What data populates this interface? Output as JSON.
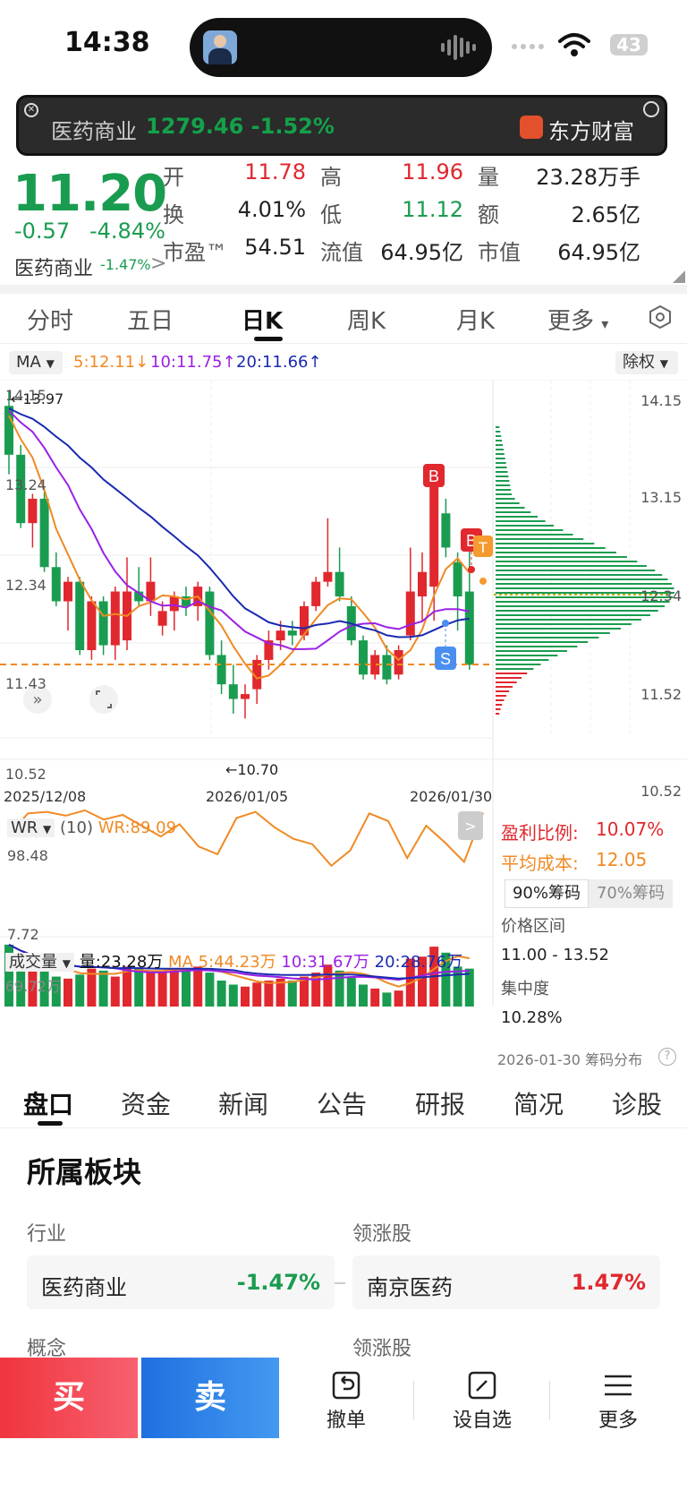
{
  "status_bar": {
    "time": "14:38",
    "battery": "43"
  },
  "banner": {
    "index_name": "医药商业",
    "index_value": "1279.46",
    "index_change": "-1.52%",
    "app_name": "东方财富"
  },
  "quote": {
    "price": "11.20",
    "change": "-0.57",
    "change_pct": "-4.84%",
    "industry": "医药商业",
    "industry_pct": "-1.47%",
    "industry_arrow": ">",
    "labels": {
      "open": "开",
      "high": "高",
      "volume": "量",
      "turnover": "换",
      "low": "低",
      "amount": "额",
      "pe": "市盈™",
      "float_cap": "流值",
      "market_cap": "市值"
    },
    "open": "11.78",
    "high": "11.96",
    "volume": "23.28万手",
    "turnover": "4.01%",
    "low": "11.12",
    "amount": "2.65亿",
    "pe": "54.51",
    "float_cap": "64.95亿",
    "market_cap": "64.95亿"
  },
  "tabs": [
    "分时",
    "五日",
    "日K",
    "周K",
    "月K",
    "更多"
  ],
  "tabs_more_arrow": "▾",
  "ma_bar": {
    "selector": "MA",
    "ma5": "5:12.11",
    "ma5_arrow": "↓",
    "ma10": "10:11.75",
    "ma10_arrow": "↑",
    "ma20": "20:11.66",
    "ma20_arrow": "↑",
    "adjust": "除权"
  },
  "kline": {
    "y_left": [
      "14.15",
      "13.24",
      "12.34",
      "11.43",
      "10.52"
    ],
    "y_right": [
      "14.15",
      "13.15",
      "12.34",
      "11.52",
      "10.52"
    ],
    "x_dates": [
      "2025/12/08",
      "2026/01/05",
      "2026/01/30"
    ],
    "max_label": "←13.97",
    "min_label": "←10.70",
    "buy_marker": "B",
    "sell_marker": "S",
    "t_marker": "T"
  },
  "chart_data": {
    "type": "candlestick",
    "ylim": [
      10.52,
      14.15
    ],
    "candles": [
      {
        "o": 13.9,
        "h": 14.05,
        "l": 13.2,
        "c": 13.4
      },
      {
        "o": 13.4,
        "h": 13.5,
        "l": 12.65,
        "c": 12.7
      },
      {
        "o": 12.7,
        "h": 13.0,
        "l": 12.45,
        "c": 12.95
      },
      {
        "o": 12.95,
        "h": 13.05,
        "l": 12.2,
        "c": 12.25
      },
      {
        "o": 12.25,
        "h": 12.4,
        "l": 11.85,
        "c": 11.9
      },
      {
        "o": 11.9,
        "h": 12.15,
        "l": 11.6,
        "c": 12.1
      },
      {
        "o": 12.1,
        "h": 12.15,
        "l": 11.35,
        "c": 11.4
      },
      {
        "o": 11.4,
        "h": 11.95,
        "l": 11.3,
        "c": 11.9
      },
      {
        "o": 11.9,
        "h": 11.95,
        "l": 11.35,
        "c": 11.45
      },
      {
        "o": 11.45,
        "h": 12.05,
        "l": 11.3,
        "c": 12.0
      },
      {
        "o": 11.5,
        "h": 12.35,
        "l": 11.4,
        "c": 12.0
      },
      {
        "o": 12.0,
        "h": 12.25,
        "l": 11.85,
        "c": 11.9
      },
      {
        "o": 11.9,
        "h": 12.35,
        "l": 11.75,
        "c": 12.1
      },
      {
        "o": 11.65,
        "h": 11.9,
        "l": 11.55,
        "c": 11.8
      },
      {
        "o": 11.8,
        "h": 12.0,
        "l": 11.6,
        "c": 11.95
      },
      {
        "o": 11.95,
        "h": 12.05,
        "l": 11.75,
        "c": 11.85
      },
      {
        "o": 11.85,
        "h": 12.1,
        "l": 11.7,
        "c": 12.05
      },
      {
        "o": 12.0,
        "h": 12.05,
        "l": 11.3,
        "c": 11.35
      },
      {
        "o": 11.35,
        "h": 11.5,
        "l": 10.95,
        "c": 11.05
      },
      {
        "o": 11.05,
        "h": 11.25,
        "l": 10.75,
        "c": 10.9
      },
      {
        "o": 10.9,
        "h": 11.05,
        "l": 10.7,
        "c": 10.95
      },
      {
        "o": 11.0,
        "h": 11.35,
        "l": 10.85,
        "c": 11.3
      },
      {
        "o": 11.3,
        "h": 11.6,
        "l": 11.2,
        "c": 11.5
      },
      {
        "o": 11.5,
        "h": 11.7,
        "l": 11.4,
        "c": 11.6
      },
      {
        "o": 11.6,
        "h": 11.7,
        "l": 11.45,
        "c": 11.55
      },
      {
        "o": 11.55,
        "h": 11.9,
        "l": 11.5,
        "c": 11.85
      },
      {
        "o": 11.85,
        "h": 12.15,
        "l": 11.8,
        "c": 12.1
      },
      {
        "o": 12.1,
        "h": 12.75,
        "l": 12.05,
        "c": 12.2
      },
      {
        "o": 12.2,
        "h": 12.45,
        "l": 11.9,
        "c": 11.95
      },
      {
        "o": 11.85,
        "h": 11.95,
        "l": 11.45,
        "c": 11.5
      },
      {
        "o": 11.5,
        "h": 11.55,
        "l": 11.1,
        "c": 11.15
      },
      {
        "o": 11.15,
        "h": 11.4,
        "l": 11.1,
        "c": 11.35
      },
      {
        "o": 11.35,
        "h": 11.45,
        "l": 11.05,
        "c": 11.1
      },
      {
        "o": 11.15,
        "h": 11.45,
        "l": 11.1,
        "c": 11.4
      },
      {
        "o": 11.55,
        "h": 12.45,
        "l": 11.5,
        "c": 12.0
      },
      {
        "o": 11.95,
        "h": 12.4,
        "l": 11.7,
        "c": 12.2
      },
      {
        "o": 12.05,
        "h": 13.2,
        "l": 11.7,
        "c": 13.1
      },
      {
        "o": 12.8,
        "h": 12.95,
        "l": 12.35,
        "c": 12.45
      },
      {
        "o": 12.3,
        "h": 12.4,
        "l": 11.6,
        "c": 11.95
      },
      {
        "o": 12.0,
        "h": 12.5,
        "l": 11.2,
        "c": 11.25
      }
    ],
    "volume_label": "成交量",
    "volume_now": "量:23.28万",
    "volume_ma": {
      "ma5": "MA 5:44.23万",
      "ma10": "10:31.67万",
      "ma20": "20:28.76万"
    },
    "volume_top_label": "69.72万"
  },
  "wr": {
    "selector": "WR",
    "param": "(10)",
    "value": "WR:89.09",
    "top": "98.48",
    "bottom": "7.72"
  },
  "chips": {
    "profit_label": "盈利比例:",
    "profit_value": "10.07%",
    "cost_label": "平均成本:",
    "cost_value": "12.05",
    "tab_90": "90%筹码",
    "tab_70": "70%筹码",
    "range_label": "价格区间",
    "range_value": "11.00 - 13.52",
    "concentration_label": "集中度",
    "concentration_value": "10.28%",
    "date": "2026-01-30 筹码分布",
    "help": "?"
  },
  "bottom_tabs": [
    "盘口",
    "资金",
    "新闻",
    "公告",
    "研报",
    "简况",
    "诊股"
  ],
  "sector": {
    "title": "所属板块",
    "industry_label": "行业",
    "leader_label": "领涨股",
    "industry_name": "医药商业",
    "industry_pct": "-1.47%",
    "leader_name": "南京医药",
    "leader_pct": "1.47%",
    "concept_label": "概念",
    "leader_label2": "领涨股"
  },
  "bottom_bar": {
    "buy": "买",
    "sell": "卖",
    "cancel": "撤单",
    "watchlist": "设自选",
    "more": "更多"
  },
  "colors": {
    "up": "#e0282e",
    "down": "#1a9c50",
    "ma5": "#f08a24",
    "ma10": "#9b20e6",
    "ma20": "#1a2ab0"
  }
}
